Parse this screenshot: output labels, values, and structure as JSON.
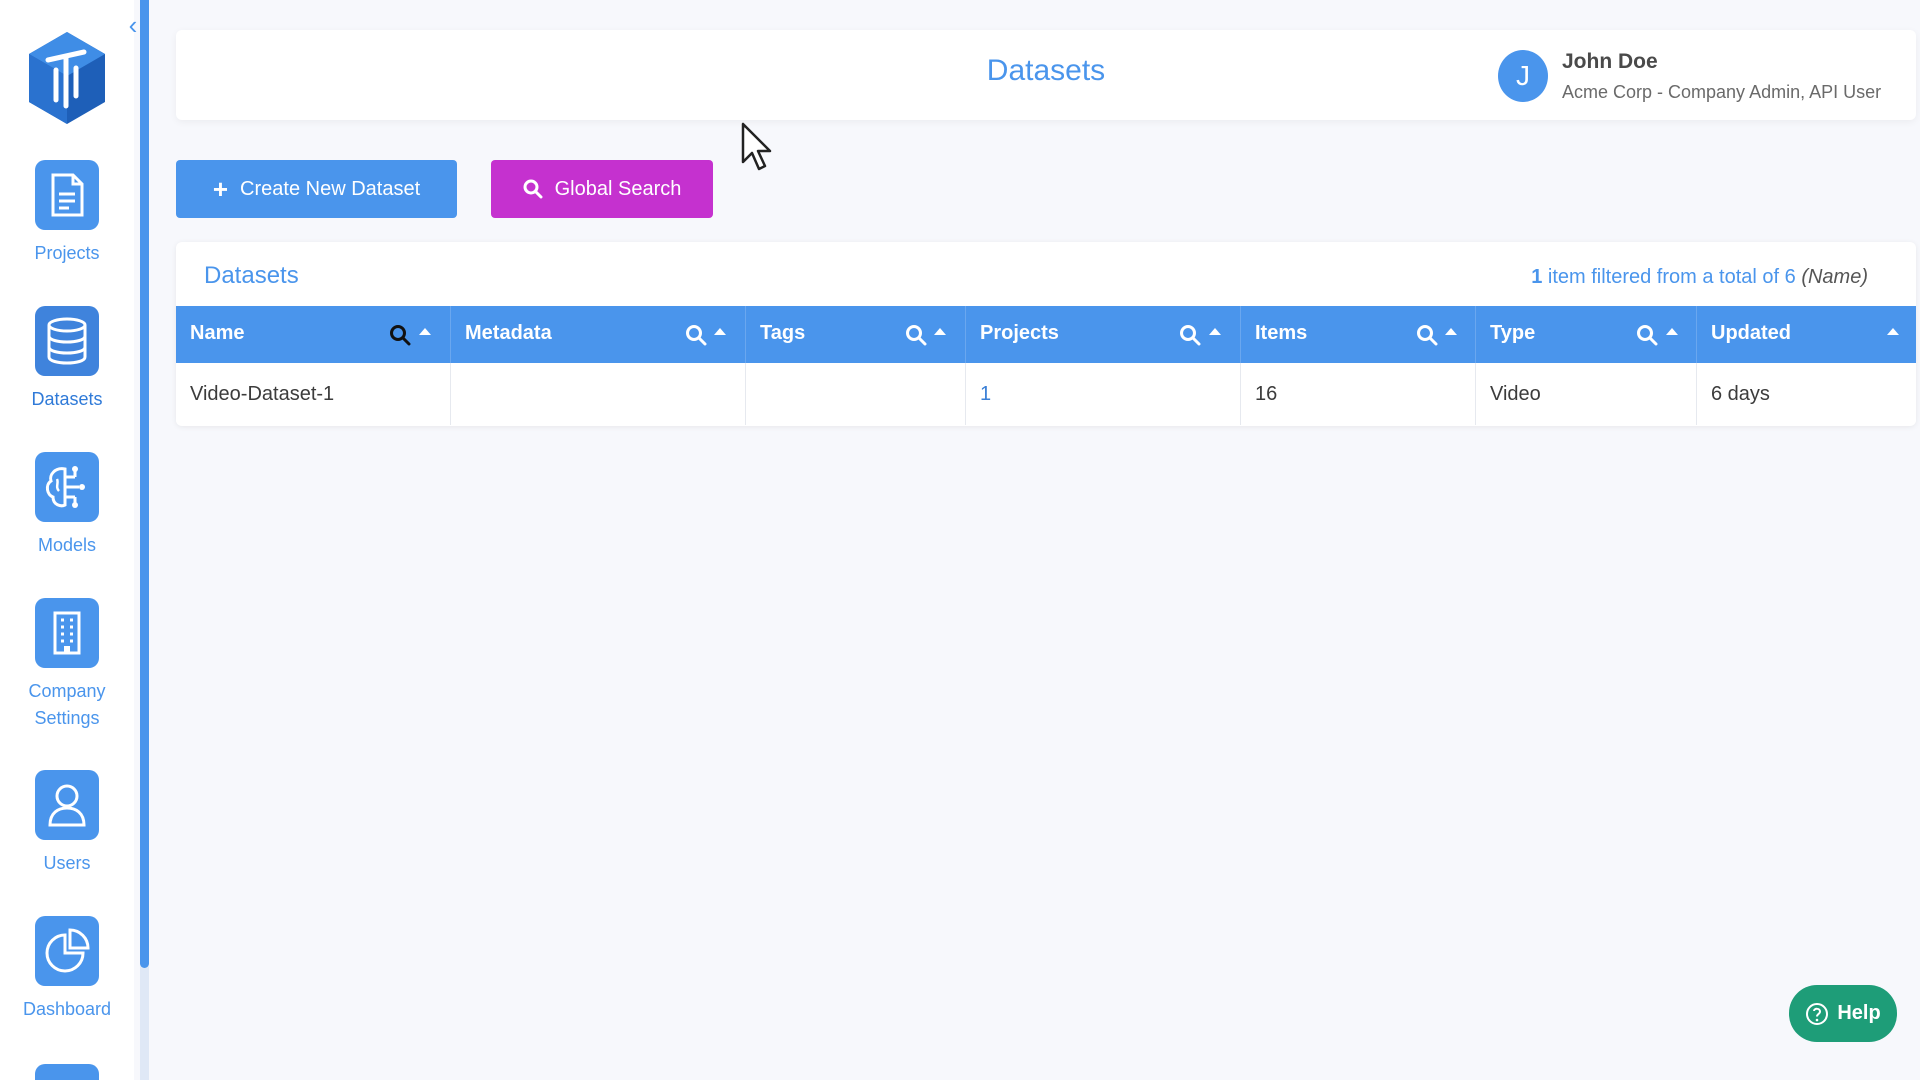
{
  "app": {
    "title": "Datasets"
  },
  "sidebar": {
    "items": [
      {
        "label": "Projects",
        "icon": "document-icon"
      },
      {
        "label": "Datasets",
        "icon": "database-icon",
        "active": true
      },
      {
        "label": "Models",
        "icon": "brain-circuit-icon"
      },
      {
        "label": "Company\nSettings",
        "icon": "building-icon"
      },
      {
        "label": "Users",
        "icon": "user-icon"
      },
      {
        "label": "Dashboard",
        "icon": "pie-chart-icon"
      }
    ]
  },
  "user": {
    "initial": "J",
    "name": "John Doe",
    "role": "Acme Corp - Company Admin, API User"
  },
  "actions": {
    "create_label": "Create New Dataset",
    "search_label": "Global Search"
  },
  "table": {
    "title": "Datasets",
    "filter_count": "1",
    "filter_text": " item filtered from a total of 6 ",
    "filter_field": "(Name)",
    "columns": [
      {
        "label": "Name",
        "searchable": true,
        "search_active": true
      },
      {
        "label": "Metadata",
        "searchable": true
      },
      {
        "label": "Tags",
        "searchable": true
      },
      {
        "label": "Projects",
        "searchable": true
      },
      {
        "label": "Items",
        "searchable": true
      },
      {
        "label": "Type",
        "searchable": true
      },
      {
        "label": "Updated",
        "searchable": false
      }
    ],
    "rows": [
      {
        "name": "Video-Dataset-1",
        "metadata": "",
        "tags": "",
        "projects": "1",
        "items": "16",
        "type": "Video",
        "updated": "6 days"
      }
    ]
  },
  "help": {
    "label": "Help"
  },
  "colors": {
    "primary": "#4a95ec",
    "global_search": "#c531cf",
    "help": "#1e9d78"
  }
}
